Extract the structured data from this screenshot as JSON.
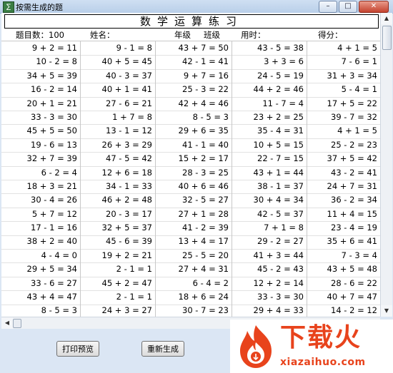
{
  "window": {
    "title": "按需生成的题"
  },
  "sheet": {
    "title": "数学运算练习",
    "header": {
      "count": "题目数：100",
      "name": "姓名：",
      "grade": "年级",
      "class": "班级",
      "time": "用时：",
      "score": "得分："
    },
    "rows": [
      [
        "9 + 2 = 11",
        "9 - 1 = 8",
        "43 + 7 = 50",
        "43 - 5 = 38",
        "4 + 1 = 5"
      ],
      [
        "10 - 2 = 8",
        "40 + 5 = 45",
        "42 - 1 = 41",
        "3 + 3 = 6",
        "7 - 6 = 1"
      ],
      [
        "34 + 5 = 39",
        "40 - 3 = 37",
        "9 + 7 = 16",
        "24 - 5 = 19",
        "31 + 3 = 34"
      ],
      [
        "16 - 2 = 14",
        "40 + 1 = 41",
        "25 - 3 = 22",
        "44 + 2 = 46",
        "5 - 4 = 1"
      ],
      [
        "20 + 1 = 21",
        "27 - 6 = 21",
        "42 + 4 = 46",
        "11 - 7 = 4",
        "17 + 5 = 22"
      ],
      [
        "33 - 3 = 30",
        "1 + 7 = 8",
        "8 - 5 = 3",
        "23 + 2 = 25",
        "39 - 7 = 32"
      ],
      [
        "45 + 5 = 50",
        "13 - 1 = 12",
        "29 + 6 = 35",
        "35 - 4 = 31",
        "4 + 1 = 5"
      ],
      [
        "19 - 6 = 13",
        "26 + 3 = 29",
        "41 - 1 = 40",
        "10 + 5 = 15",
        "25 - 2 = 23"
      ],
      [
        "32 + 7 = 39",
        "47 - 5 = 42",
        "15 + 2 = 17",
        "22 - 7 = 15",
        "37 + 5 = 42"
      ],
      [
        "6 - 2 = 4",
        "12 + 6 = 18",
        "28 - 3 = 25",
        "43 + 1 = 44",
        "43 - 2 = 41"
      ],
      [
        "18 + 3 = 21",
        "34 - 1 = 33",
        "40 + 6 = 46",
        "38 - 1 = 37",
        "24 + 7 = 31"
      ],
      [
        "30 - 4 = 26",
        "46 + 2 = 48",
        "32 - 5 = 27",
        "30 + 4 = 34",
        "36 - 2 = 34"
      ],
      [
        "5 + 7 = 12",
        "20 - 3 = 17",
        "27 + 1 = 28",
        "42 - 5 = 37",
        "11 + 4 = 15"
      ],
      [
        "17 - 1 = 16",
        "32 + 5 = 37",
        "41 - 2 = 39",
        "7 + 1 = 8",
        "23 - 4 = 19"
      ],
      [
        "38 + 2 = 40",
        "45 - 6 = 39",
        "13 + 4 = 17",
        "29 - 2 = 27",
        "35 + 6 = 41"
      ],
      [
        "4 - 4 = 0",
        "19 + 2 = 21",
        "25 - 5 = 20",
        "41 + 3 = 44",
        "7 - 3 = 4"
      ],
      [
        "29 + 5 = 34",
        "2 - 1 = 1",
        "27 + 4 = 31",
        "45 - 2 = 43",
        "43 + 5 = 48"
      ],
      [
        "33 - 6 = 27",
        "45 + 2 = 47",
        "6 - 4 = 2",
        "12 + 2 = 14",
        "28 - 6 = 22"
      ],
      [
        "43 + 4 = 47",
        "2 - 1 = 1",
        "18 + 6 = 24",
        "33 - 3 = 30",
        "40 + 7 = 47"
      ],
      [
        "8 - 5 = 3",
        "24 + 3 = 27",
        "30 - 7 = 23",
        "29 + 4 = 33",
        "14 - 2 = 12"
      ]
    ]
  },
  "buttons": {
    "print_preview": "打印预览",
    "regenerate": "重新生成"
  },
  "watermark": {
    "brand": "下载火",
    "url": "xiazaihuo.com"
  },
  "colors": {
    "brand": "#e8431c"
  }
}
